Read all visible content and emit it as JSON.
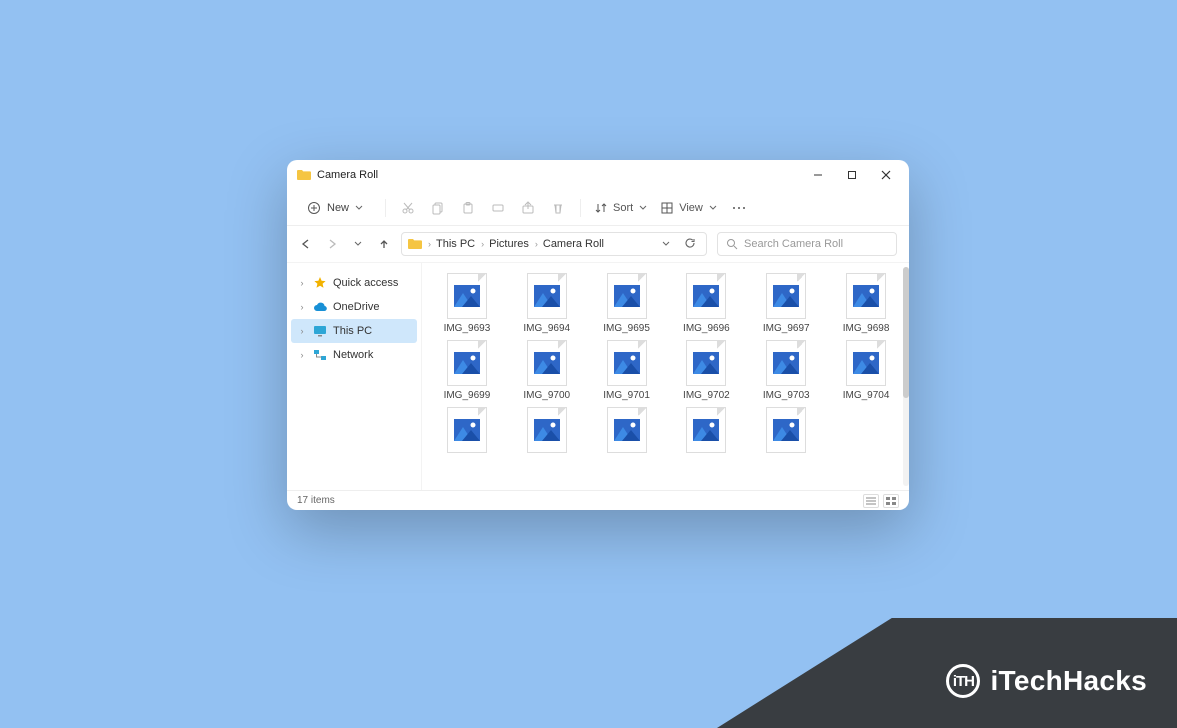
{
  "window": {
    "title": "Camera Roll"
  },
  "toolbar": {
    "new_label": "New",
    "sort_label": "Sort",
    "view_label": "View"
  },
  "breadcrumb": {
    "items": [
      "This PC",
      "Pictures",
      "Camera Roll"
    ]
  },
  "search": {
    "placeholder": "Search Camera Roll"
  },
  "sidebar": {
    "items": [
      {
        "label": "Quick access",
        "icon": "star",
        "color": "#f2b200"
      },
      {
        "label": "OneDrive",
        "icon": "cloud",
        "color": "#1890d6"
      },
      {
        "label": "This PC",
        "icon": "monitor",
        "color": "#2ea6d6",
        "selected": true
      },
      {
        "label": "Network",
        "icon": "network",
        "color": "#2ea6d6"
      }
    ]
  },
  "files": {
    "items": [
      "IMG_9693",
      "IMG_9694",
      "IMG_9695",
      "IMG_9696",
      "IMG_9697",
      "IMG_9698",
      "IMG_9699",
      "IMG_9700",
      "IMG_9701",
      "IMG_9702",
      "IMG_9703",
      "IMG_9704",
      "",
      "",
      "",
      "",
      ""
    ],
    "visible_with_label": 12,
    "partial_row": 5
  },
  "status": {
    "count_text": "17 items"
  },
  "watermark": {
    "text": "iTechHacks",
    "logo_text": "iTH"
  }
}
